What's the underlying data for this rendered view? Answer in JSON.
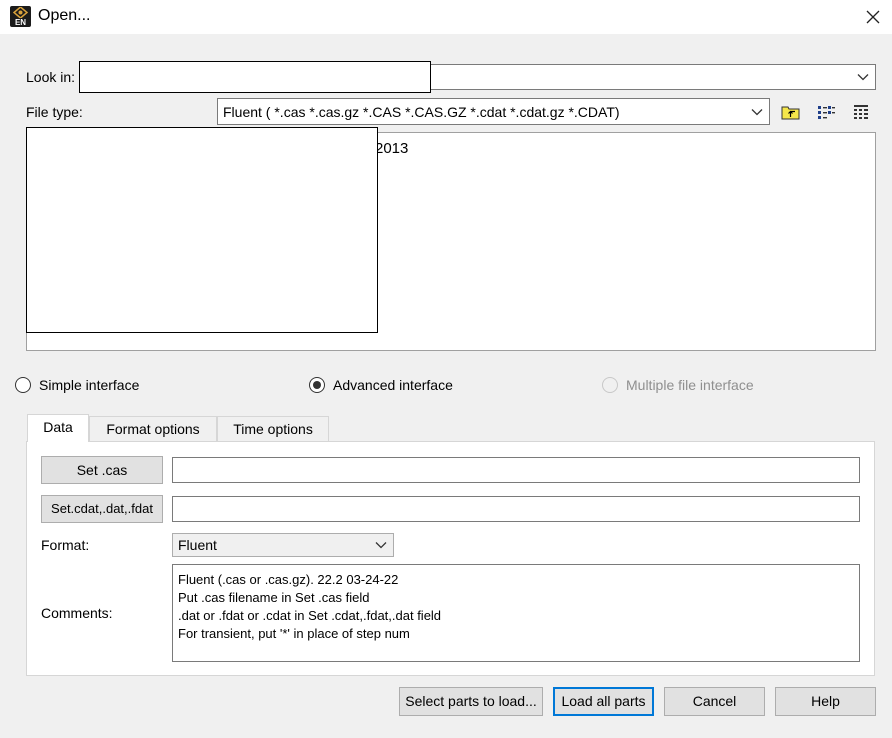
{
  "window": {
    "title": "Open...",
    "app_icon_text": "EN"
  },
  "look_in": {
    "label": "Look in:",
    "value": ""
  },
  "file_type": {
    "label": "File type:",
    "value": "Fluent ( *.cas *.cas.gz *.CAS *.CAS.GZ *.cdat *.cdat.gz *.CDAT)"
  },
  "toolbar_icons": [
    "up-folder-icon",
    "list-view-icon",
    "details-view-icon"
  ],
  "file_list": {
    "partial_item_text": "2013"
  },
  "interface_mode": {
    "options": [
      {
        "label": "Simple interface",
        "checked": false,
        "enabled": true
      },
      {
        "label": "Advanced interface",
        "checked": true,
        "enabled": true
      },
      {
        "label": "Multiple file interface",
        "checked": false,
        "enabled": false
      }
    ]
  },
  "tabs": [
    {
      "label": "Data",
      "active": true
    },
    {
      "label": "Format options",
      "active": false
    },
    {
      "label": "Time options",
      "active": false
    }
  ],
  "data_tab": {
    "set_cas_label": "Set .cas",
    "set_cas_value": "",
    "set_cdat_label": "Set.cdat,.dat,.fdat",
    "set_cdat_value": "",
    "format_label": "Format:",
    "format_value": "Fluent",
    "comments_label": "Comments:",
    "comments_lines": [
      "Fluent (.cas or .cas.gz).  22.2 03-24-22",
      "Put .cas filename in Set .cas field",
      ".dat or .fdat or .cdat in Set .cdat,.fdat,.dat field",
      "For transient, put '*' in place of step num"
    ]
  },
  "buttons": {
    "select_parts": "Select parts to load...",
    "load_all": "Load all parts",
    "cancel": "Cancel",
    "help": "Help"
  },
  "colors": {
    "dialog_bg": "#f0f0f0",
    "focus_accent": "#0078d7",
    "disabled_text": "#8f8f8f",
    "icon_yellow": "#f5e64a"
  }
}
